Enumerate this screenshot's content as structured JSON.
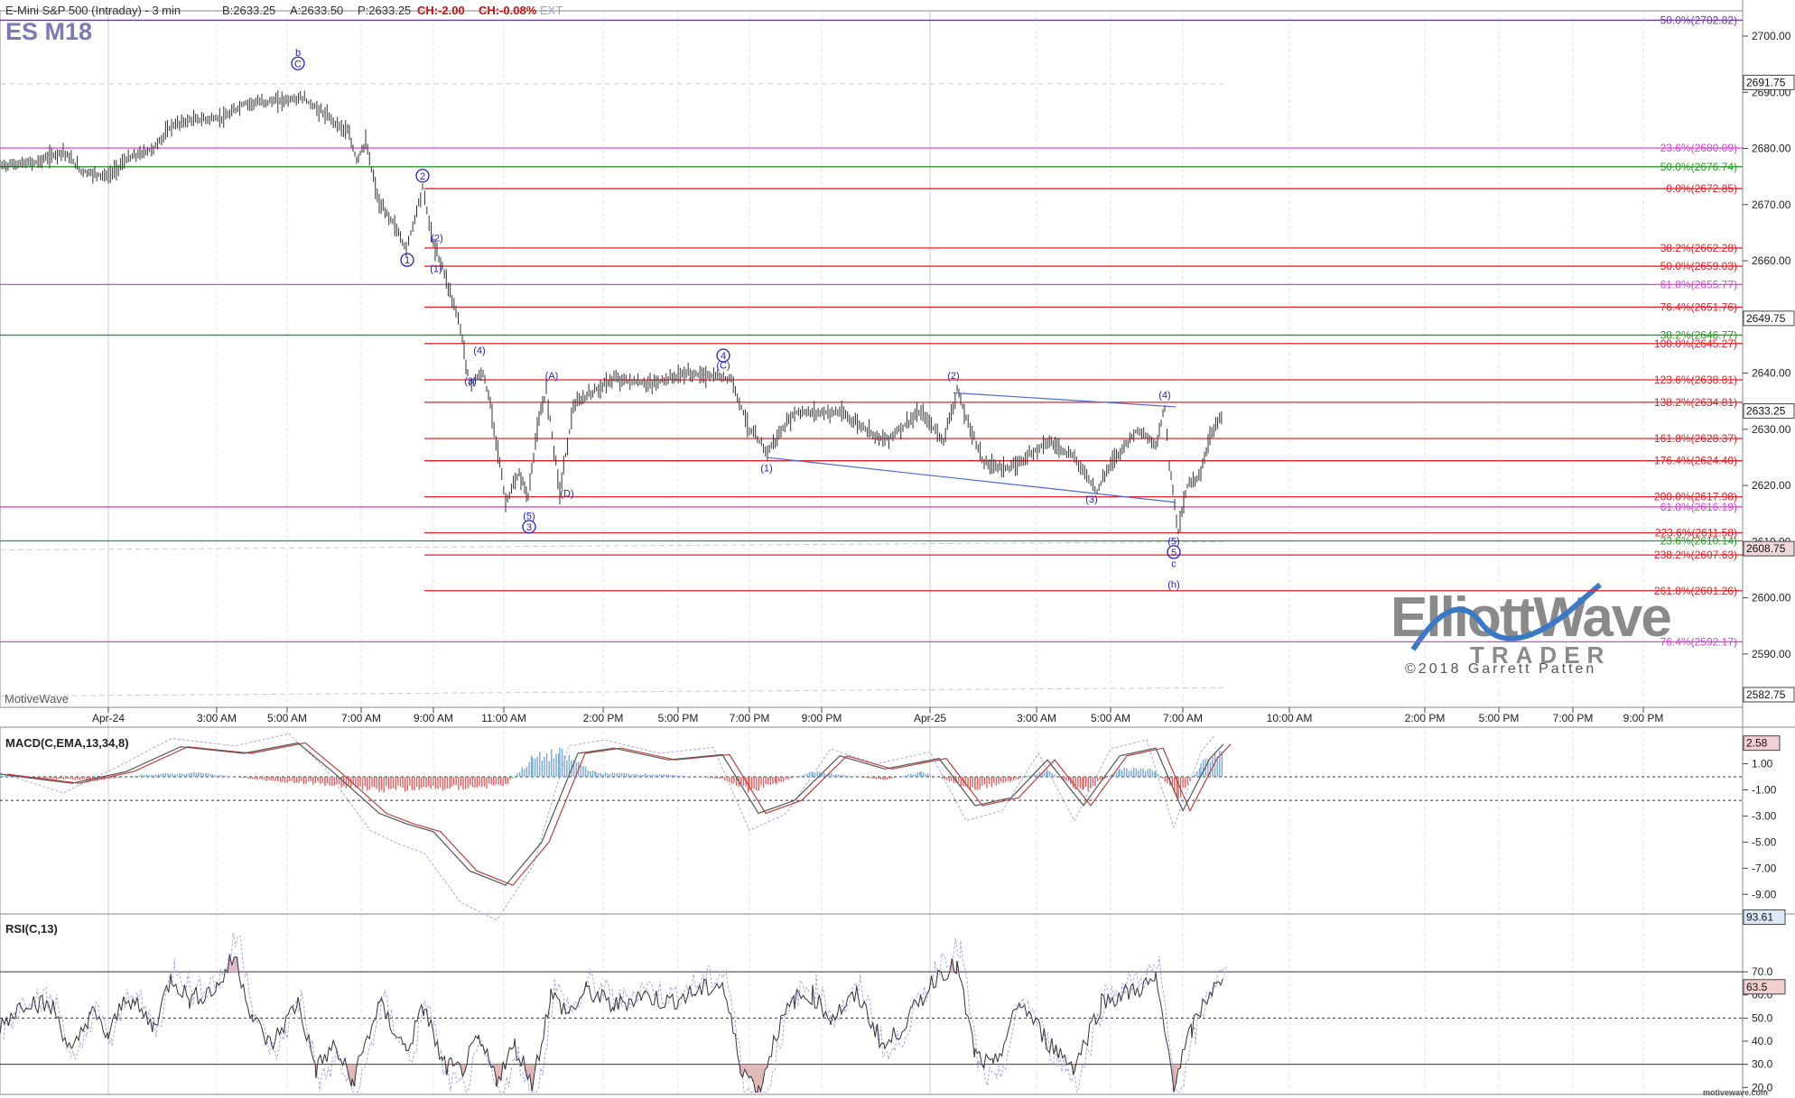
{
  "header": {
    "instrument": "E-Mini S&P 500 (Intraday) - 3 min",
    "bid": "B:2633.25",
    "ask": "A:2633.50",
    "price": "P:2633.25",
    "change": "CH:-2.00",
    "change_pct": "CH:-0.08%",
    "ext": "EXT",
    "symbol": "ES M18",
    "watermark": "MotiveWave",
    "footer_url": "motivewave.com"
  },
  "logo": {
    "line1": "ElliottWave",
    "line2": "TRADER",
    "copyright": "©2018 Garrett Patten"
  },
  "colors": {
    "red": "#e8202a",
    "magenta": "#e040e0",
    "green": "#2a9a2a",
    "purple": "#6a3aa8",
    "blue": "#2020d0",
    "price_bar": "#303030",
    "macd_pos": "#7aa8d8",
    "macd_neg": "#e86060"
  },
  "chart_data": [
    {
      "type": "line",
      "panel": "price",
      "y_axis_ticks": [
        "2700.00",
        "2690.00",
        "2680.00",
        "2670.00",
        "2660.00",
        "2650.00",
        "2640.00",
        "2630.00",
        "2620.00",
        "2610.00",
        "2600.00",
        "2590.00"
      ],
      "ylim": [
        2580.5,
        2704.5
      ],
      "x_tick_labels": [
        "Apr-24",
        "3:00 AM",
        "5:00 AM",
        "7:00 AM",
        "9:00 AM",
        "11:00 AM",
        "2:00 PM",
        "5:00 PM",
        "7:00 PM",
        "9:00 PM",
        "Apr-25",
        "3:00 AM",
        "5:00 AM",
        "7:00 AM",
        "10:00 AM",
        "2:00 PM",
        "5:00 PM",
        "7:00 PM",
        "9:00 PM"
      ],
      "price_path": [
        [
          0,
          2677
        ],
        [
          0.04,
          2677.5
        ],
        [
          0.07,
          2679.5
        ],
        [
          0.09,
          2676
        ],
        [
          0.12,
          2675
        ],
        [
          0.14,
          2678
        ],
        [
          0.17,
          2680
        ],
        [
          0.19,
          2684
        ],
        [
          0.21,
          2685
        ],
        [
          0.25,
          2685.5
        ],
        [
          0.27,
          2688
        ],
        [
          0.31,
          2688.5
        ],
        [
          0.335,
          2689
        ],
        [
          0.36,
          2686
        ],
        [
          0.385,
          2683
        ],
        [
          0.395,
          2678
        ],
        [
          0.405,
          2681
        ],
        [
          0.42,
          2670
        ],
        [
          0.435,
          2667
        ],
        [
          0.45,
          2662
        ],
        [
          0.455,
          2665
        ],
        [
          0.468,
          2673
        ],
        [
          0.48,
          2663
        ],
        [
          0.49,
          2659
        ],
        [
          0.505,
          2651
        ],
        [
          0.51,
          2648
        ],
        [
          0.52,
          2638
        ],
        [
          0.535,
          2640
        ],
        [
          0.545,
          2633
        ],
        [
          0.56,
          2617
        ],
        [
          0.575,
          2622
        ],
        [
          0.585,
          2618
        ],
        [
          0.595,
          2630
        ],
        [
          0.605,
          2637
        ],
        [
          0.62,
          2619
        ],
        [
          0.635,
          2634
        ],
        [
          0.65,
          2636
        ],
        [
          0.68,
          2639
        ],
        [
          0.72,
          2638
        ],
        [
          0.76,
          2640
        ],
        [
          0.81,
          2639
        ],
        [
          0.83,
          2630
        ],
        [
          0.85,
          2626
        ],
        [
          0.88,
          2633
        ],
        [
          0.93,
          2633
        ],
        [
          0.98,
          2628
        ],
        [
          1.02,
          2633
        ],
        [
          1.045,
          2628
        ],
        [
          1.06,
          2637
        ],
        [
          1.07,
          2632
        ],
        [
          1.09,
          2624
        ],
        [
          1.12,
          2623
        ],
        [
          1.16,
          2628
        ],
        [
          1.19,
          2625
        ],
        [
          1.215,
          2619
        ],
        [
          1.23,
          2624
        ],
        [
          1.26,
          2630
        ],
        [
          1.28,
          2627
        ],
        [
          1.29,
          2634
        ],
        [
          1.295,
          2624
        ],
        [
          1.305,
          2612
        ],
        [
          1.315,
          2620
        ],
        [
          1.33,
          2622
        ],
        [
          1.34,
          2629
        ],
        [
          1.355,
          2633
        ]
      ],
      "fib_levels": [
        {
          "label": "50.0%(2702.82)",
          "value": 2702.82,
          "color": "purple"
        },
        {
          "label": "23.6%(2680.09)",
          "value": 2680.09,
          "color": "magenta"
        },
        {
          "label": "50.0%(2676.74)",
          "value": 2676.74,
          "color": "green"
        },
        {
          "label": "0.0%(2672.85)",
          "value": 2672.85,
          "color": "red"
        },
        {
          "label": "38.2%(2662.28)",
          "value": 2662.28,
          "color": "red"
        },
        {
          "label": "50.0%(2659.03)",
          "value": 2659.03,
          "color": "red"
        },
        {
          "label": "61.8%(2655.77)",
          "value": 2655.77,
          "color": "magenta"
        },
        {
          "label": "76.4%(2651.76)",
          "value": 2651.76,
          "color": "red"
        },
        {
          "label": "38.2%(2646.77)",
          "value": 2646.77,
          "color": "green"
        },
        {
          "label": "100.0%(2645.27)",
          "value": 2645.27,
          "color": "red"
        },
        {
          "label": "123.6%(2638.81)",
          "value": 2638.81,
          "color": "red"
        },
        {
          "label": "138.2%(2634.81)",
          "value": 2634.81,
          "color": "red"
        },
        {
          "label": "161.8%(2628.37)",
          "value": 2628.37,
          "color": "red"
        },
        {
          "label": "176.4%(2624.40)",
          "value": 2624.4,
          "color": "red"
        },
        {
          "label": "200.0%(2617.98)",
          "value": 2617.98,
          "color": "red"
        },
        {
          "label": "61.8%(2616.19)",
          "value": 2616.19,
          "color": "magenta"
        },
        {
          "label": "223.6%(2611.58)",
          "value": 2611.58,
          "color": "red"
        },
        {
          "label": "23.6%(2610.14)",
          "value": 2610.14,
          "color": "green"
        },
        {
          "label": "238.2%(2607.63)",
          "value": 2607.63,
          "color": "red"
        },
        {
          "label": "261.8%(2601.26)",
          "value": 2601.26,
          "color": "red"
        },
        {
          "label": "76.4%(2592.17)",
          "value": 2592.17,
          "color": "magenta"
        }
      ],
      "price_badges": [
        {
          "label": "2691.75",
          "value": 2691.75
        },
        {
          "label": "2649.75",
          "value": 2649.75
        },
        {
          "label": "2633.25",
          "value": 2633.25
        },
        {
          "label": "2608.75",
          "value": 2608.75
        },
        {
          "label": "2582.75",
          "value": 2582.75
        }
      ],
      "wave_labels": [
        {
          "text": "b",
          "t": 0.33,
          "v": 2696.5,
          "circled": false
        },
        {
          "text": "C",
          "t": 0.33,
          "v": 2694.5,
          "circled": true
        },
        {
          "text": "2",
          "t": 0.468,
          "v": 2674.5,
          "circled": true
        },
        {
          "text": "(2)",
          "t": 0.484,
          "v": 2663.5,
          "circled": false
        },
        {
          "text": "1",
          "t": 0.451,
          "v": 2659.5,
          "circled": true
        },
        {
          "text": "(1)",
          "t": 0.483,
          "v": 2658,
          "circled": false
        },
        {
          "text": "(4)",
          "t": 0.531,
          "v": 2643.5,
          "circled": false
        },
        {
          "text": "(3)",
          "t": 0.521,
          "v": 2638,
          "circled": false
        },
        {
          "text": "(A)",
          "t": 0.611,
          "v": 2639,
          "circled": false
        },
        {
          "text": "(5)",
          "t": 0.586,
          "v": 2614,
          "circled": false
        },
        {
          "text": "3",
          "t": 0.586,
          "v": 2612,
          "circled": true
        },
        {
          "text": "(D)",
          "t": 0.628,
          "v": 2618,
          "circled": false
        },
        {
          "text": "4",
          "t": 0.801,
          "v": 2642.5,
          "circled": true
        },
        {
          "text": "(C)",
          "t": 0.801,
          "v": 2640.8,
          "circled": false
        },
        {
          "text": "(1)",
          "t": 0.849,
          "v": 2622.5,
          "circled": false
        },
        {
          "text": "(2)",
          "t": 1.056,
          "v": 2639,
          "circled": false
        },
        {
          "text": "(3)",
          "t": 1.209,
          "v": 2617,
          "circled": false
        },
        {
          "text": "(4)",
          "t": 1.29,
          "v": 2635.5,
          "circled": false
        },
        {
          "text": "(5)",
          "t": 1.3,
          "v": 2609.5,
          "circled": false
        },
        {
          "text": "5",
          "t": 1.3,
          "v": 2607.5,
          "circled": true
        },
        {
          "text": "c",
          "t": 1.3,
          "v": 2605.5,
          "circled": false
        },
        {
          "text": "(h)",
          "t": 1.3,
          "v": 2601.8,
          "circled": false
        }
      ],
      "trend_lines": [
        {
          "from": [
            1.056,
            2636.5
          ],
          "to": [
            1.302,
            2634
          ]
        },
        {
          "from": [
            0.849,
            2625
          ],
          "to": [
            1.302,
            2617
          ]
        }
      ]
    },
    {
      "type": "line",
      "panel": "macd",
      "label": "MACD(C,EMA,13,34,8)",
      "ylim": [
        -10.5,
        3.8
      ],
      "y_axis_ticks": [
        "1.00",
        "-1.00",
        "-3.00",
        "-5.00",
        "-7.00",
        "-9.00"
      ],
      "y_tick_values": [
        1,
        -1,
        -3,
        -5,
        -7,
        -9
      ],
      "badge": {
        "label": "2.58",
        "value": 2.58
      },
      "reference_lines": [
        0,
        -1.8
      ],
      "macd_path": [
        [
          0,
          0.2
        ],
        [
          0.08,
          -0.5
        ],
        [
          0.14,
          0.4
        ],
        [
          0.2,
          2.3
        ],
        [
          0.27,
          1.8
        ],
        [
          0.33,
          2.6
        ],
        [
          0.37,
          0.3
        ],
        [
          0.42,
          -2.8
        ],
        [
          0.45,
          -3.6
        ],
        [
          0.48,
          -4.2
        ],
        [
          0.52,
          -7.2
        ],
        [
          0.56,
          -8.3
        ],
        [
          0.6,
          -5
        ],
        [
          0.64,
          1.8
        ],
        [
          0.68,
          2.2
        ],
        [
          0.74,
          1.3
        ],
        [
          0.8,
          1.7
        ],
        [
          0.84,
          -2.8
        ],
        [
          0.88,
          -1.8
        ],
        [
          0.93,
          1.6
        ],
        [
          0.98,
          0.6
        ],
        [
          1.04,
          1.4
        ],
        [
          1.08,
          -2.2
        ],
        [
          1.12,
          -1.6
        ],
        [
          1.16,
          1.3
        ],
        [
          1.2,
          -2.2
        ],
        [
          1.24,
          1.6
        ],
        [
          1.28,
          2.2
        ],
        [
          1.31,
          -2.6
        ],
        [
          1.34,
          1.4
        ],
        [
          1.355,
          2.5
        ]
      ],
      "hist_segments": [
        [
          0,
          0.1
        ],
        [
          0.1,
          -0.4
        ],
        [
          0.16,
          0.2
        ],
        [
          0.22,
          0.4
        ],
        [
          0.3,
          -0.4
        ],
        [
          0.36,
          -0.7
        ],
        [
          0.42,
          -1.2
        ],
        [
          0.5,
          -1.1
        ],
        [
          0.56,
          -0.8
        ],
        [
          0.59,
          1.8
        ],
        [
          0.62,
          2.3
        ],
        [
          0.66,
          0.4
        ],
        [
          0.74,
          0.2
        ],
        [
          0.8,
          -0.2
        ],
        [
          0.83,
          -1.3
        ],
        [
          0.86,
          -0.6
        ],
        [
          0.9,
          0.5
        ],
        [
          0.98,
          -0.3
        ],
        [
          1.02,
          0.5
        ],
        [
          1.08,
          -1.2
        ],
        [
          1.12,
          -0.4
        ],
        [
          1.16,
          0.6
        ],
        [
          1.2,
          -1.5
        ],
        [
          1.24,
          0.8
        ],
        [
          1.28,
          0.6
        ],
        [
          1.305,
          -2.1
        ],
        [
          1.33,
          1.2
        ],
        [
          1.355,
          2.5
        ]
      ]
    },
    {
      "type": "line",
      "panel": "rsi",
      "label": "RSI(C,13)",
      "ylim": [
        17,
        95
      ],
      "y_axis_ticks": [
        "70.0",
        "60.0",
        "50.0",
        "40.0",
        "30.0",
        "20.0"
      ],
      "y_tick_values": [
        70,
        60,
        50,
        40,
        30,
        20
      ],
      "badges": [
        {
          "label": "93.61",
          "value": 93.61
        },
        {
          "label": "63.5",
          "value": 63.5
        }
      ],
      "reference_lines": [
        70,
        50,
        30
      ],
      "rsi_path": [
        [
          0,
          47
        ],
        [
          0.03,
          58
        ],
        [
          0.06,
          54
        ],
        [
          0.08,
          34
        ],
        [
          0.1,
          53
        ],
        [
          0.12,
          42
        ],
        [
          0.14,
          60
        ],
        [
          0.17,
          46
        ],
        [
          0.19,
          68
        ],
        [
          0.21,
          58
        ],
        [
          0.24,
          63
        ],
        [
          0.26,
          77
        ],
        [
          0.28,
          50
        ],
        [
          0.3,
          38
        ],
        [
          0.33,
          57
        ],
        [
          0.35,
          28
        ],
        [
          0.37,
          38
        ],
        [
          0.39,
          22
        ],
        [
          0.42,
          56
        ],
        [
          0.45,
          36
        ],
        [
          0.47,
          55
        ],
        [
          0.49,
          30
        ],
        [
          0.51,
          27
        ],
        [
          0.53,
          40
        ],
        [
          0.55,
          24
        ],
        [
          0.57,
          38
        ],
        [
          0.59,
          22
        ],
        [
          0.61,
          60
        ],
        [
          0.63,
          52
        ],
        [
          0.65,
          62
        ],
        [
          0.68,
          55
        ],
        [
          0.71,
          60
        ],
        [
          0.74,
          57
        ],
        [
          0.77,
          61
        ],
        [
          0.8,
          65
        ],
        [
          0.82,
          30
        ],
        [
          0.84,
          18
        ],
        [
          0.86,
          44
        ],
        [
          0.88,
          58
        ],
        [
          0.9,
          60
        ],
        [
          0.92,
          50
        ],
        [
          0.95,
          60
        ],
        [
          0.98,
          37
        ],
        [
          1.01,
          52
        ],
        [
          1.04,
          70
        ],
        [
          1.06,
          72
        ],
        [
          1.08,
          34
        ],
        [
          1.1,
          28
        ],
        [
          1.13,
          57
        ],
        [
          1.16,
          40
        ],
        [
          1.19,
          29
        ],
        [
          1.22,
          57
        ],
        [
          1.25,
          61
        ],
        [
          1.28,
          66
        ],
        [
          1.3,
          22
        ],
        [
          1.32,
          45
        ],
        [
          1.34,
          62
        ],
        [
          1.355,
          64
        ]
      ]
    }
  ]
}
